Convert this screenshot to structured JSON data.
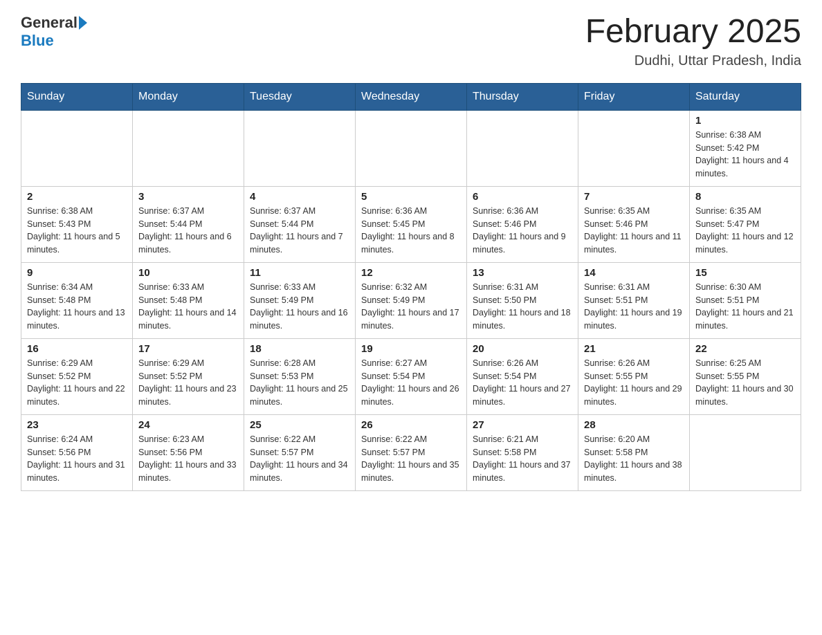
{
  "header": {
    "logo_general": "General",
    "logo_blue": "Blue",
    "title": "February 2025",
    "location": "Dudhi, Uttar Pradesh, India"
  },
  "days_of_week": [
    "Sunday",
    "Monday",
    "Tuesday",
    "Wednesday",
    "Thursday",
    "Friday",
    "Saturday"
  ],
  "weeks": [
    {
      "days": [
        {
          "date": "",
          "sunrise": "",
          "sunset": "",
          "daylight": "",
          "empty": true
        },
        {
          "date": "",
          "sunrise": "",
          "sunset": "",
          "daylight": "",
          "empty": true
        },
        {
          "date": "",
          "sunrise": "",
          "sunset": "",
          "daylight": "",
          "empty": true
        },
        {
          "date": "",
          "sunrise": "",
          "sunset": "",
          "daylight": "",
          "empty": true
        },
        {
          "date": "",
          "sunrise": "",
          "sunset": "",
          "daylight": "",
          "empty": true
        },
        {
          "date": "",
          "sunrise": "",
          "sunset": "",
          "daylight": "",
          "empty": true
        },
        {
          "date": "1",
          "sunrise": "Sunrise: 6:38 AM",
          "sunset": "Sunset: 5:42 PM",
          "daylight": "Daylight: 11 hours and 4 minutes.",
          "empty": false
        }
      ]
    },
    {
      "days": [
        {
          "date": "2",
          "sunrise": "Sunrise: 6:38 AM",
          "sunset": "Sunset: 5:43 PM",
          "daylight": "Daylight: 11 hours and 5 minutes.",
          "empty": false
        },
        {
          "date": "3",
          "sunrise": "Sunrise: 6:37 AM",
          "sunset": "Sunset: 5:44 PM",
          "daylight": "Daylight: 11 hours and 6 minutes.",
          "empty": false
        },
        {
          "date": "4",
          "sunrise": "Sunrise: 6:37 AM",
          "sunset": "Sunset: 5:44 PM",
          "daylight": "Daylight: 11 hours and 7 minutes.",
          "empty": false
        },
        {
          "date": "5",
          "sunrise": "Sunrise: 6:36 AM",
          "sunset": "Sunset: 5:45 PM",
          "daylight": "Daylight: 11 hours and 8 minutes.",
          "empty": false
        },
        {
          "date": "6",
          "sunrise": "Sunrise: 6:36 AM",
          "sunset": "Sunset: 5:46 PM",
          "daylight": "Daylight: 11 hours and 9 minutes.",
          "empty": false
        },
        {
          "date": "7",
          "sunrise": "Sunrise: 6:35 AM",
          "sunset": "Sunset: 5:46 PM",
          "daylight": "Daylight: 11 hours and 11 minutes.",
          "empty": false
        },
        {
          "date": "8",
          "sunrise": "Sunrise: 6:35 AM",
          "sunset": "Sunset: 5:47 PM",
          "daylight": "Daylight: 11 hours and 12 minutes.",
          "empty": false
        }
      ]
    },
    {
      "days": [
        {
          "date": "9",
          "sunrise": "Sunrise: 6:34 AM",
          "sunset": "Sunset: 5:48 PM",
          "daylight": "Daylight: 11 hours and 13 minutes.",
          "empty": false
        },
        {
          "date": "10",
          "sunrise": "Sunrise: 6:33 AM",
          "sunset": "Sunset: 5:48 PM",
          "daylight": "Daylight: 11 hours and 14 minutes.",
          "empty": false
        },
        {
          "date": "11",
          "sunrise": "Sunrise: 6:33 AM",
          "sunset": "Sunset: 5:49 PM",
          "daylight": "Daylight: 11 hours and 16 minutes.",
          "empty": false
        },
        {
          "date": "12",
          "sunrise": "Sunrise: 6:32 AM",
          "sunset": "Sunset: 5:49 PM",
          "daylight": "Daylight: 11 hours and 17 minutes.",
          "empty": false
        },
        {
          "date": "13",
          "sunrise": "Sunrise: 6:31 AM",
          "sunset": "Sunset: 5:50 PM",
          "daylight": "Daylight: 11 hours and 18 minutes.",
          "empty": false
        },
        {
          "date": "14",
          "sunrise": "Sunrise: 6:31 AM",
          "sunset": "Sunset: 5:51 PM",
          "daylight": "Daylight: 11 hours and 19 minutes.",
          "empty": false
        },
        {
          "date": "15",
          "sunrise": "Sunrise: 6:30 AM",
          "sunset": "Sunset: 5:51 PM",
          "daylight": "Daylight: 11 hours and 21 minutes.",
          "empty": false
        }
      ]
    },
    {
      "days": [
        {
          "date": "16",
          "sunrise": "Sunrise: 6:29 AM",
          "sunset": "Sunset: 5:52 PM",
          "daylight": "Daylight: 11 hours and 22 minutes.",
          "empty": false
        },
        {
          "date": "17",
          "sunrise": "Sunrise: 6:29 AM",
          "sunset": "Sunset: 5:52 PM",
          "daylight": "Daylight: 11 hours and 23 minutes.",
          "empty": false
        },
        {
          "date": "18",
          "sunrise": "Sunrise: 6:28 AM",
          "sunset": "Sunset: 5:53 PM",
          "daylight": "Daylight: 11 hours and 25 minutes.",
          "empty": false
        },
        {
          "date": "19",
          "sunrise": "Sunrise: 6:27 AM",
          "sunset": "Sunset: 5:54 PM",
          "daylight": "Daylight: 11 hours and 26 minutes.",
          "empty": false
        },
        {
          "date": "20",
          "sunrise": "Sunrise: 6:26 AM",
          "sunset": "Sunset: 5:54 PM",
          "daylight": "Daylight: 11 hours and 27 minutes.",
          "empty": false
        },
        {
          "date": "21",
          "sunrise": "Sunrise: 6:26 AM",
          "sunset": "Sunset: 5:55 PM",
          "daylight": "Daylight: 11 hours and 29 minutes.",
          "empty": false
        },
        {
          "date": "22",
          "sunrise": "Sunrise: 6:25 AM",
          "sunset": "Sunset: 5:55 PM",
          "daylight": "Daylight: 11 hours and 30 minutes.",
          "empty": false
        }
      ]
    },
    {
      "days": [
        {
          "date": "23",
          "sunrise": "Sunrise: 6:24 AM",
          "sunset": "Sunset: 5:56 PM",
          "daylight": "Daylight: 11 hours and 31 minutes.",
          "empty": false
        },
        {
          "date": "24",
          "sunrise": "Sunrise: 6:23 AM",
          "sunset": "Sunset: 5:56 PM",
          "daylight": "Daylight: 11 hours and 33 minutes.",
          "empty": false
        },
        {
          "date": "25",
          "sunrise": "Sunrise: 6:22 AM",
          "sunset": "Sunset: 5:57 PM",
          "daylight": "Daylight: 11 hours and 34 minutes.",
          "empty": false
        },
        {
          "date": "26",
          "sunrise": "Sunrise: 6:22 AM",
          "sunset": "Sunset: 5:57 PM",
          "daylight": "Daylight: 11 hours and 35 minutes.",
          "empty": false
        },
        {
          "date": "27",
          "sunrise": "Sunrise: 6:21 AM",
          "sunset": "Sunset: 5:58 PM",
          "daylight": "Daylight: 11 hours and 37 minutes.",
          "empty": false
        },
        {
          "date": "28",
          "sunrise": "Sunrise: 6:20 AM",
          "sunset": "Sunset: 5:58 PM",
          "daylight": "Daylight: 11 hours and 38 minutes.",
          "empty": false
        },
        {
          "date": "",
          "sunrise": "",
          "sunset": "",
          "daylight": "",
          "empty": true
        }
      ]
    }
  ]
}
